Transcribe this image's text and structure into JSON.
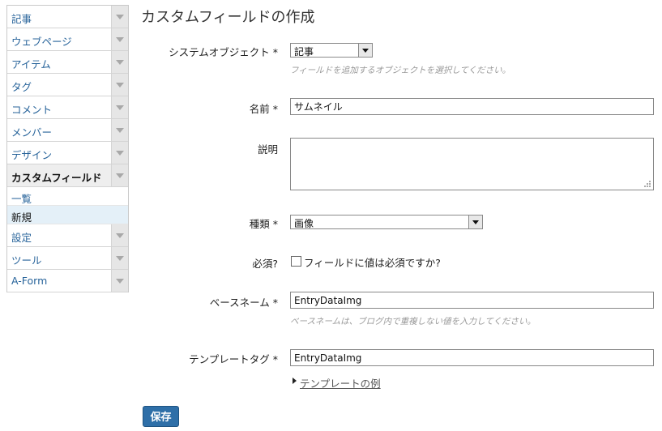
{
  "sidebar": {
    "items": [
      {
        "label": "記事"
      },
      {
        "label": "ウェブページ"
      },
      {
        "label": "アイテム"
      },
      {
        "label": "タグ"
      },
      {
        "label": "コメント"
      },
      {
        "label": "メンバー"
      },
      {
        "label": "デザイン"
      },
      {
        "label": "カスタムフィールド"
      },
      {
        "label": "設定"
      },
      {
        "label": "ツール"
      },
      {
        "label": "A-Form"
      }
    ],
    "sub_items": [
      {
        "label": "一覧"
      },
      {
        "label": "新規"
      }
    ]
  },
  "page": {
    "title": "カスタムフィールドの作成"
  },
  "form": {
    "system_object": {
      "label": "システムオブジェクト *",
      "value": "記事",
      "hint": "フィールドを追加するオブジェクトを選択してください。"
    },
    "name": {
      "label": "名前 *",
      "value": "サムネイル"
    },
    "description": {
      "label": "説明",
      "value": ""
    },
    "type": {
      "label": "種類 *",
      "value": "画像"
    },
    "required": {
      "label": "必須?",
      "checkbox_label": "フィールドに値は必須ですか?",
      "checked": false
    },
    "basename": {
      "label": "ベースネーム *",
      "value": "EntryDataImg",
      "hint": "ベースネームは、ブログ内で重複しない値を入力してください。"
    },
    "template_tag": {
      "label": "テンプレートタグ *",
      "value": "EntryDataImg"
    },
    "template_example": {
      "label": "テンプレートの例"
    },
    "save_label": "保存"
  }
}
